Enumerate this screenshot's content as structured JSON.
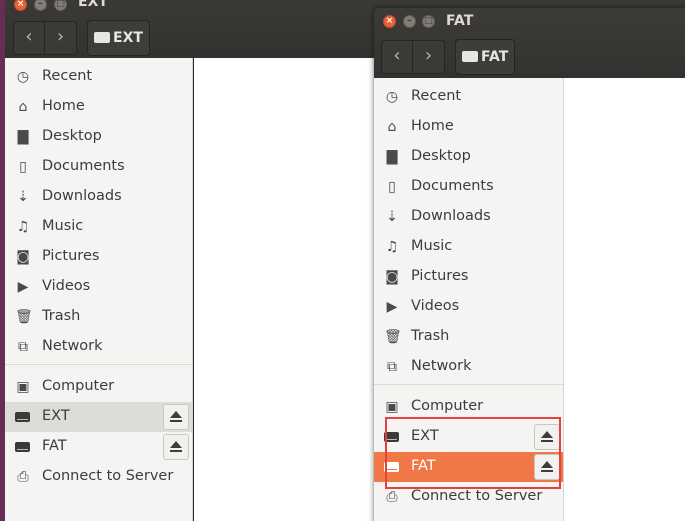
{
  "back_window": {
    "title": "EXT",
    "path_label": "EXT",
    "sidebar": [
      {
        "label": "Recent",
        "icon": "clock-icon"
      },
      {
        "label": "Home",
        "icon": "home-icon"
      },
      {
        "label": "Desktop",
        "icon": "folder-icon"
      },
      {
        "label": "Documents",
        "icon": "document-icon"
      },
      {
        "label": "Downloads",
        "icon": "download-icon"
      },
      {
        "label": "Music",
        "icon": "music-icon"
      },
      {
        "label": "Pictures",
        "icon": "camera-icon"
      },
      {
        "label": "Videos",
        "icon": "video-icon"
      },
      {
        "label": "Trash",
        "icon": "trash-icon"
      },
      {
        "label": "Network",
        "icon": "network-icon"
      },
      {
        "label": "Computer",
        "icon": "computer-icon"
      },
      {
        "label": "EXT",
        "icon": "drive-icon",
        "selected": true
      },
      {
        "label": "FAT",
        "icon": "drive-icon"
      },
      {
        "label": "Connect to Server",
        "icon": "server-icon"
      }
    ]
  },
  "front_window": {
    "title": "FAT",
    "path_label": "FAT",
    "sidebar": [
      {
        "label": "Recent",
        "icon": "clock-icon"
      },
      {
        "label": "Home",
        "icon": "home-icon"
      },
      {
        "label": "Desktop",
        "icon": "folder-icon"
      },
      {
        "label": "Documents",
        "icon": "document-icon"
      },
      {
        "label": "Downloads",
        "icon": "download-icon"
      },
      {
        "label": "Music",
        "icon": "music-icon"
      },
      {
        "label": "Pictures",
        "icon": "camera-icon"
      },
      {
        "label": "Videos",
        "icon": "video-icon"
      },
      {
        "label": "Trash",
        "icon": "trash-icon"
      },
      {
        "label": "Network",
        "icon": "network-icon"
      },
      {
        "label": "Computer",
        "icon": "computer-icon"
      },
      {
        "label": "EXT",
        "icon": "drive-icon"
      },
      {
        "label": "FAT",
        "icon": "drive-icon",
        "selected": true
      },
      {
        "label": "Connect to Server",
        "icon": "server-icon"
      }
    ]
  },
  "colors": {
    "accent": "#f07746",
    "highlight_box": "#e5413e",
    "titlebar": "#3c3b37"
  }
}
